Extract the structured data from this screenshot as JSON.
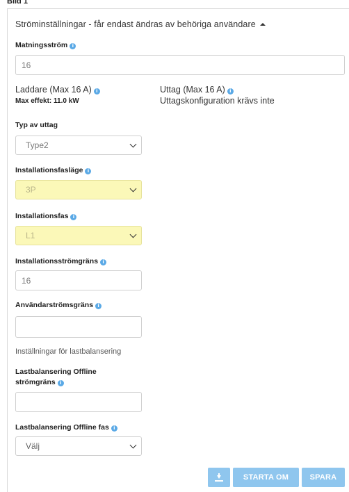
{
  "top_label": "Bild 1",
  "section": {
    "title": "Ströminställningar - får endast ändras av behöriga användare"
  },
  "supply_current": {
    "label": "Matningsström",
    "value": "16"
  },
  "charger": {
    "label": "Laddare (Max 16 A)",
    "max_power": "Max effekt: 11.0 kW"
  },
  "outlet": {
    "label": "Uttag (Max 16 A)",
    "note": "Uttagskonfiguration krävs inte"
  },
  "outlet_type": {
    "label": "Typ av uttag",
    "value": "Type2"
  },
  "install_phase_mode": {
    "label": "Installationsfasläge",
    "value": "3P"
  },
  "install_phase": {
    "label": "Installationsfas",
    "value": "L1"
  },
  "install_current_limit": {
    "label": "Installationsströmgräns",
    "value": "16"
  },
  "user_current_limit": {
    "label": "Användarströmsgräns",
    "value": ""
  },
  "load_balancing": {
    "heading": "Inställningar för lastbalansering"
  },
  "lb_offline_current": {
    "label_line1": "Lastbalansering Offline",
    "label_line2": "strömgräns",
    "value": ""
  },
  "lb_offline_phase": {
    "label": "Lastbalansering Offline fas",
    "value": "Välj"
  },
  "buttons": {
    "restart": "STARTA OM",
    "save": "SPARA"
  },
  "icons": {
    "info": "info-icon",
    "download": "download-icon",
    "chevron": "chevron-down-icon"
  },
  "colors": {
    "info": "#5aa9e6",
    "highlight": "#fbf8b8",
    "button": "#8fc6ee"
  }
}
